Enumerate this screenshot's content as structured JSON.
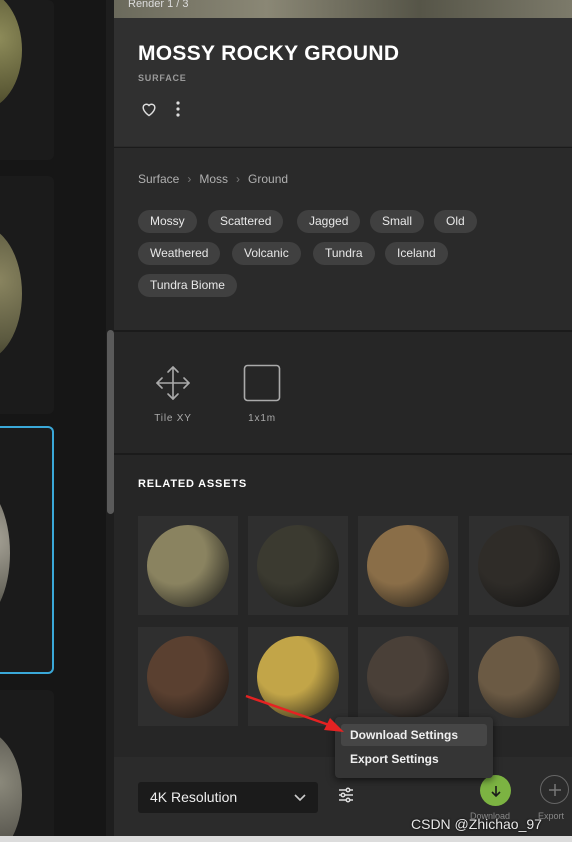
{
  "hero": {
    "render_label": "Render 1 / 3"
  },
  "asset": {
    "title": "MOSSY ROCKY GROUND",
    "type": "SURFACE"
  },
  "breadcrumb": [
    "Surface",
    "Moss",
    "Ground"
  ],
  "tags": [
    "Mossy",
    "Scattered",
    "Jagged",
    "Small",
    "Old",
    "Weathered",
    "Volcanic",
    "Tundra",
    "Iceland",
    "Tundra Biome"
  ],
  "properties": [
    {
      "icon": "tile-xy-icon",
      "label": "Tile XY"
    },
    {
      "icon": "square-size-icon",
      "label": "1x1m"
    }
  ],
  "related": {
    "title": "RELATED ASSETS",
    "colors": [
      "#8a8360",
      "#3b3a30",
      "#8a6e48",
      "#2f2c28",
      "#5a4030",
      "#c2a548",
      "#4a4038",
      "#6b5a44"
    ]
  },
  "bottom": {
    "resolution": "4K Resolution",
    "download_label": "Download",
    "export_label": "Export"
  },
  "menu": {
    "items": [
      "Download Settings",
      "Export Settings"
    ]
  },
  "watermark": "CSDN @Zhichao_97",
  "colors": {
    "accent_green": "#7cb342",
    "selection_blue": "#3aa8d8",
    "annotation_red": "#e52222"
  }
}
